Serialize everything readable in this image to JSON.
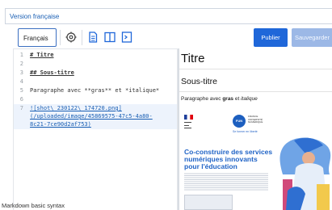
{
  "version_bar": {
    "label": "Version française"
  },
  "toolbar": {
    "language_button": "Français",
    "icons": [
      "settings-icon",
      "document-icon",
      "split-view-icon",
      "preview-icon"
    ],
    "publish_button": "Publier",
    "save_button": "Sauvegarder"
  },
  "editor": {
    "lines": [
      {
        "n": "1",
        "text": "# Titre"
      },
      {
        "n": "2",
        "text": ""
      },
      {
        "n": "3",
        "text": "## Sous-titre"
      },
      {
        "n": "4",
        "text": ""
      },
      {
        "n": "5",
        "text": "Paragraphe avec **gras** et *italique*"
      },
      {
        "n": "6",
        "text": ""
      },
      {
        "n": "7",
        "text": "![shot\\_230122\\_174720.png]"
      },
      {
        "n": "",
        "text": "(/uploaded/image/45869575-47c5-4a80-"
      },
      {
        "n": "",
        "text": "8c21-7ce90d2af753)"
      }
    ]
  },
  "status": {
    "label": "Markdown basic syntax"
  },
  "preview": {
    "title": "Titre",
    "subtitle": "Sous-titre",
    "paragraph": {
      "prefix": "Paragraphe avec ",
      "bold": "gras",
      "middle": " et ",
      "italic": "italique"
    },
    "image": {
      "logo_text": "FUN",
      "partner_lines": [
        "FRANCE",
        "UNIVERSITÉ",
        "NUMÉRIQUE"
      ],
      "tagline": "Se former en liberté",
      "headline": "Co-construire des services numériques innovants pour l'éducation"
    }
  },
  "colors": {
    "accent": "#1f67d9",
    "accent_disabled": "#9cb8e6",
    "link": "#1a5fb4"
  }
}
